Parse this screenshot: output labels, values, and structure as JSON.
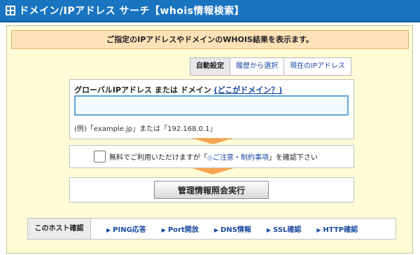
{
  "title": "ドメイン/IPアドレス サーチ【whois情報検索】",
  "notice": "ご指定のIPアドレスやドメインのWHOIS結果を表示ます。",
  "mode_tabs": [
    {
      "label": "自動設定",
      "active": true
    },
    {
      "label": "履歴から選択",
      "active": false
    },
    {
      "label": "現在のIPアドレス",
      "active": false
    }
  ],
  "input": {
    "label": "グローバルIPアドレス または ドメイン",
    "help_link": "(どこがドメイン？)",
    "value": "",
    "example": "(例)「example.jp」または「192.168.0.1」"
  },
  "agree": {
    "checked": false,
    "text_before": "無料でご利用いただけますが「",
    "link_icon": "◎",
    "link": "ご注意・制約事項",
    "text_after": "」を確認下さい"
  },
  "submit_label": "管理情報照会実行",
  "host_check": {
    "label": "このホスト確認",
    "links": [
      {
        "label": "PING応答",
        "icon": "triangle-right-icon"
      },
      {
        "label": "Port開放",
        "icon": "triangle-right-icon"
      },
      {
        "label": "DNS情報",
        "icon": "triangle-right-icon"
      },
      {
        "label": "SSL確認",
        "icon": "triangle-right-icon"
      },
      {
        "label": "HTTP確認",
        "icon": "triangle-right-icon"
      }
    ]
  },
  "colors": {
    "titlebar": "#1a74c0",
    "panel_bg": "#fffbd6",
    "notice_bg": "#fde2b8",
    "arrow": "#f6a552",
    "link": "#1a4aa0"
  }
}
